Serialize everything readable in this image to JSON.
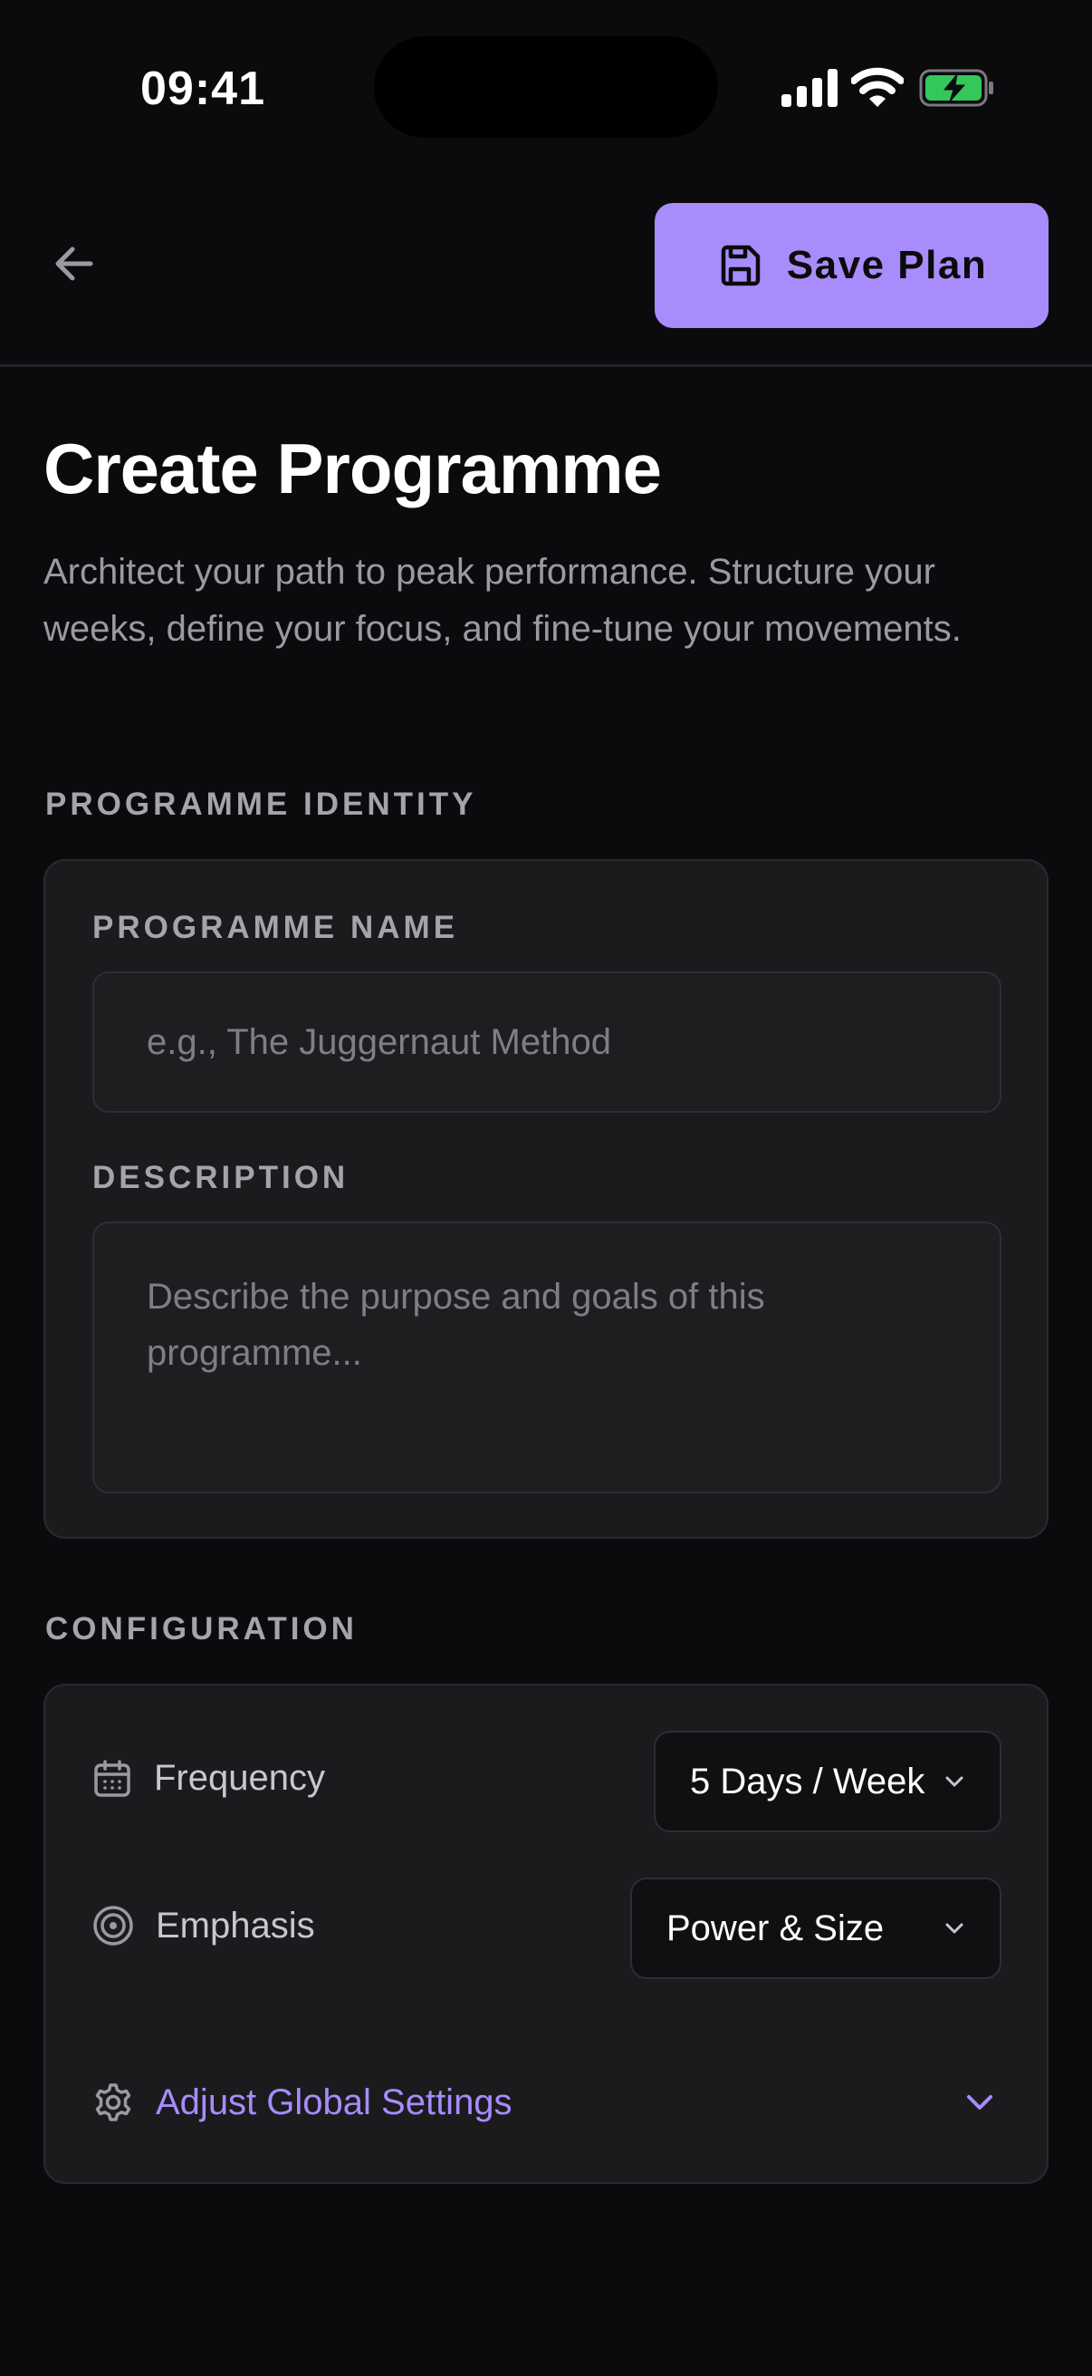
{
  "status_bar": {
    "time": "09:41",
    "icons": [
      "cellular-signal-icon",
      "wifi-icon",
      "battery-charging-icon"
    ]
  },
  "header": {
    "back_icon": "arrow-left-icon",
    "save_button": {
      "label": "Save Plan",
      "icon": "save-floppy-icon"
    }
  },
  "page": {
    "title": "Create Programme",
    "subtitle": "Architect your path to peak performance. Structure your weeks, define your focus, and fine-tune your movements."
  },
  "identity": {
    "section_label": "PROGRAMME IDENTITY",
    "name_label": "PROGRAMME NAME",
    "name_placeholder": "e.g., The Juggernaut Method",
    "description_label": "DESCRIPTION",
    "description_placeholder": "Describe the purpose and goals of this programme..."
  },
  "configuration": {
    "section_label": "CONFIGURATION",
    "frequency": {
      "label": "Frequency",
      "icon": "calendar-icon",
      "value": "5 Days / Week"
    },
    "emphasis": {
      "label": "Emphasis",
      "icon": "target-icon",
      "value": "Power & Size"
    },
    "adjust": {
      "label": "Adjust Global Settings",
      "icon": "gear-icon"
    }
  },
  "colors": {
    "background": "#0b0b0d",
    "card": "#1b1b1e",
    "accent": "#a88cfb",
    "muted_text": "#9a9aa2",
    "battery": "#34c759"
  }
}
